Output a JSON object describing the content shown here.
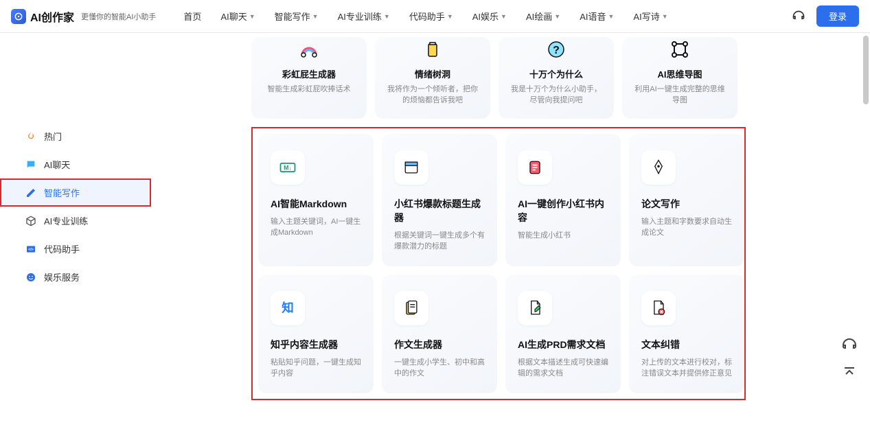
{
  "header": {
    "logo_text": "AI创作家",
    "tagline": "更懂你的智能AI小助手",
    "nav": [
      {
        "label": "首页",
        "chev": false
      },
      {
        "label": "AI聊天",
        "chev": true
      },
      {
        "label": "智能写作",
        "chev": true
      },
      {
        "label": "AI专业训练",
        "chev": true
      },
      {
        "label": "代码助手",
        "chev": true
      },
      {
        "label": "AI娱乐",
        "chev": true
      },
      {
        "label": "AI绘画",
        "chev": true
      },
      {
        "label": "AI语音",
        "chev": true
      },
      {
        "label": "AI写诗",
        "chev": true
      }
    ],
    "login_label": "登录"
  },
  "sidebar": {
    "items": [
      {
        "label": "热门",
        "icon": "fire",
        "color": "#ff7d2b"
      },
      {
        "label": "AI聊天",
        "icon": "chat",
        "color": "#3aaef5"
      },
      {
        "label": "智能写作",
        "icon": "edit",
        "color": "#2b6fec",
        "active": true
      },
      {
        "label": "AI专业训练",
        "icon": "cube",
        "color": "#555"
      },
      {
        "label": "代码助手",
        "icon": "code",
        "color": "#2b6fec"
      },
      {
        "label": "娱乐服务",
        "icon": "smile",
        "color": "#2b6fec"
      }
    ]
  },
  "row1": [
    {
      "title": "彩虹屁生成器",
      "desc": "智能生成彩虹屁吹捧话术",
      "icon": "rainbow"
    },
    {
      "title": "情绪树洞",
      "desc": "我将作为一个倾听者，把你的烦恼都告诉我吧",
      "icon": "cup"
    },
    {
      "title": "十万个为什么",
      "desc": "我是十万个为什么小助手，尽管向我提问吧",
      "icon": "question"
    },
    {
      "title": "AI思维导图",
      "desc": "利用AI一键生成完整的思维导图",
      "icon": "flow"
    }
  ],
  "row2": [
    {
      "title": "AI智能Markdown",
      "desc": "输入主题关键词，AI一键生成Markdown",
      "icon": "markdown"
    },
    {
      "title": "小红书爆款标题生成器",
      "desc": "根据关键词一键生成多个有爆款潜力的标题",
      "icon": "window"
    },
    {
      "title": "AI一键创作小红书内容",
      "desc": "智能生成小红书",
      "icon": "note"
    },
    {
      "title": "论文写作",
      "desc": "输入主题和字数要求自动生成论文",
      "icon": "pen"
    }
  ],
  "row3": [
    {
      "title": "知乎内容生成器",
      "desc": "粘贴知乎问题，一键生成知乎内容",
      "icon": "zhi"
    },
    {
      "title": "作文生成器",
      "desc": "一键生成小学生、初中和高中的作文",
      "icon": "paper"
    },
    {
      "title": "AI生成PRD需求文档",
      "desc": "根据文本描述生成可快速编辑的需求文档",
      "icon": "docpen"
    },
    {
      "title": "文本纠错",
      "desc": "对上传的文本进行校对，标注错误文本并提供修正意见",
      "icon": "docx"
    }
  ]
}
